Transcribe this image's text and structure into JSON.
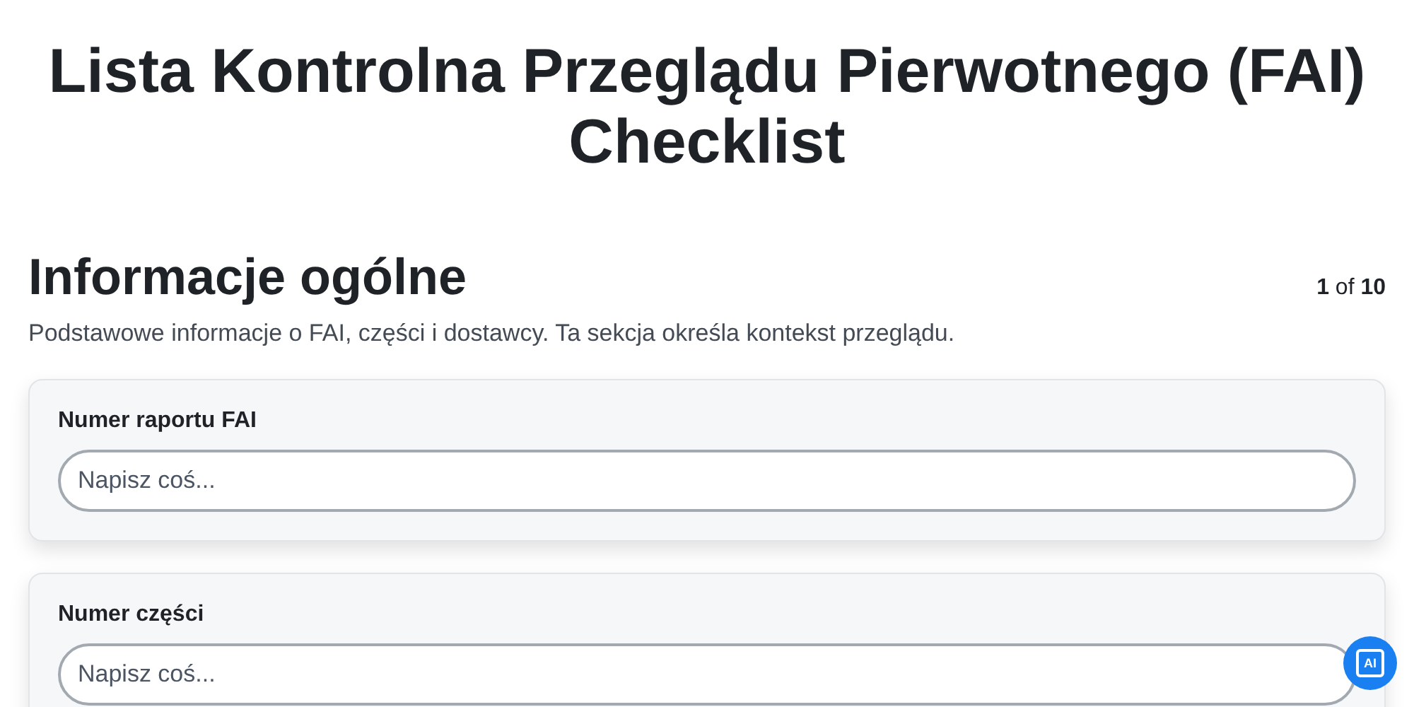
{
  "title": "Lista Kontrolna Przeglądu Pierwotnego (FAI) Checklist",
  "section": {
    "heading": "Informacje ogólne",
    "progress": "**1** of **10**",
    "description": "Podstawowe informacje o FAI, części i dostawcy. Ta sekcja określa kontekst przeglądu."
  },
  "fields": [
    {
      "label": "Numer raportu FAI",
      "placeholder": "Napisz coś..."
    },
    {
      "label": "Numer części",
      "placeholder": "Napisz coś..."
    }
  ],
  "ai_badge": {
    "label": "AI"
  }
}
